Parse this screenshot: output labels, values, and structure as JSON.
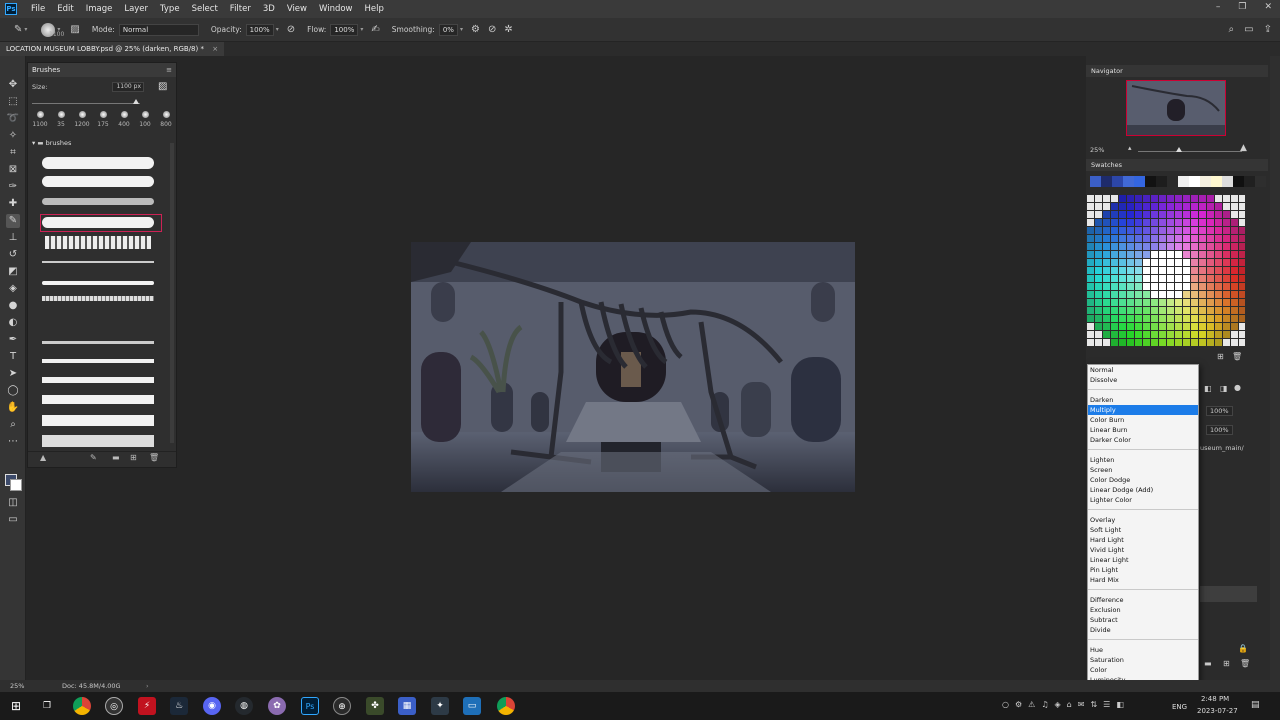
{
  "app": {
    "logo": "Ps"
  },
  "menu": [
    "File",
    "Edit",
    "Image",
    "Layer",
    "Type",
    "Select",
    "Filter",
    "3D",
    "View",
    "Window",
    "Help"
  ],
  "options": {
    "brush_size": "1100",
    "mode_label": "Mode:",
    "mode_value": "Normal",
    "opacity_label": "Opacity:",
    "opacity_value": "100%",
    "flow_label": "Flow:",
    "flow_value": "100%",
    "smoothing_label": "Smoothing:",
    "smoothing_value": "0%"
  },
  "document": {
    "tab_title": "LOCATION MUSEUM LOBBY.psd @ 25% (darken, RGB/8) *",
    "close": "×"
  },
  "brushes_panel": {
    "title": "Brushes",
    "size_label": "Size:",
    "size_value": "1100 px",
    "size_fraction": 0.94,
    "presets": [
      "1100",
      "35",
      "1200",
      "175",
      "400",
      "100",
      "800"
    ],
    "folder": "brushes"
  },
  "navigator": {
    "title": "Navigator",
    "zoom": "25%"
  },
  "swatches": {
    "title": "Swatches",
    "recent": [
      "#3b5fc7",
      "#1e2b6b",
      "#2c46a8",
      "#4169d6",
      "#3466e0",
      "#121212",
      "#1d1d1d",
      "#2a2a2a",
      "#f0f0f0",
      "#ffffff",
      "#f5f0e0",
      "#fff8d0",
      "#dddddd",
      "#101010",
      "#202020",
      "#2e2e2e"
    ]
  },
  "blend_modes": {
    "selected": "Multiply",
    "groups": [
      [
        "Normal",
        "Dissolve"
      ],
      [
        "Darken",
        "Multiply",
        "Color Burn",
        "Linear Burn",
        "Darker Color"
      ],
      [
        "Lighten",
        "Screen",
        "Color Dodge",
        "Linear Dodge (Add)",
        "Lighter Color"
      ],
      [
        "Overlay",
        "Soft Light",
        "Hard Light",
        "Vivid Light",
        "Linear Light",
        "Pin Light",
        "Hard Mix"
      ],
      [
        "Difference",
        "Exclusion",
        "Subtract",
        "Divide"
      ],
      [
        "Hue",
        "Saturation",
        "Color",
        "Luminosity"
      ]
    ]
  },
  "layers_panel": {
    "opacity": "100%",
    "fill": "100%",
    "layer_name": "useum_main/"
  },
  "status": {
    "zoom": "25%",
    "doc": "Doc: 45.8M/4.00G"
  },
  "taskbar": {
    "lang": "ENG",
    "time": "2:48 PM",
    "date": "2023-07-27"
  }
}
